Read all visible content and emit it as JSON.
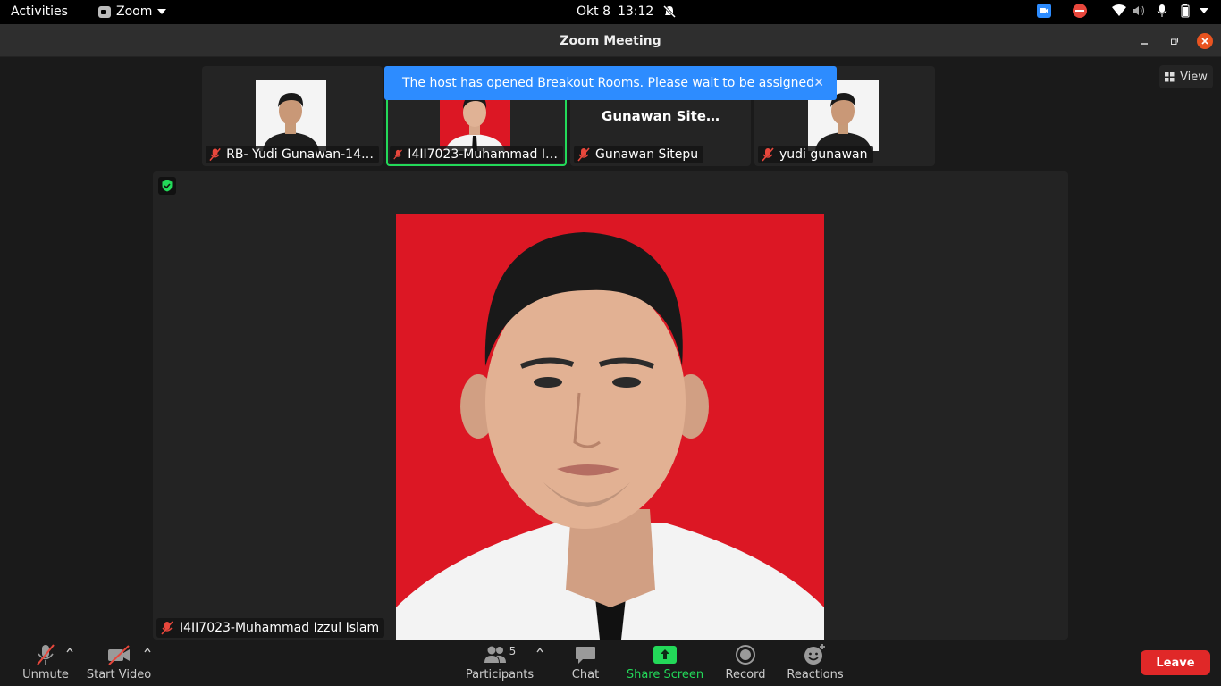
{
  "topbar": {
    "activities": "Activities",
    "app_name": "Zoom",
    "date": "Okt 8",
    "time": "13:12"
  },
  "window": {
    "title": "Zoom Meeting"
  },
  "view_button": {
    "label": "View"
  },
  "notification": {
    "text": "The host has opened Breakout Rooms. Please wait to be assigned"
  },
  "thumbnails": [
    {
      "name": "RB- Yudi Gunawan-14…",
      "has_video": true,
      "active": false
    },
    {
      "name": "I4II7023-Muhammad I…",
      "has_video": true,
      "active": true
    },
    {
      "name": "Gunawan Sitepu",
      "display_name": "Gunawan Site…",
      "has_video": false,
      "active": false
    },
    {
      "name": "yudi gunawan",
      "has_video": true,
      "active": false
    }
  ],
  "main_video": {
    "name": "I4II7023-Muhammad Izzul Islam"
  },
  "toolbar": {
    "unmute": "Unmute",
    "start_video": "Start Video",
    "participants": "Participants",
    "participants_count": "5",
    "chat": "Chat",
    "share_screen": "Share Screen",
    "record": "Record",
    "reactions": "Reactions",
    "leave": "Leave"
  },
  "colors": {
    "accent_blue": "#2d8cff",
    "active_speaker": "#23d959",
    "share_green": "#23d959",
    "leave_red": "#e02828",
    "muted_red": "#e8473c",
    "close_orange": "#e95420"
  }
}
